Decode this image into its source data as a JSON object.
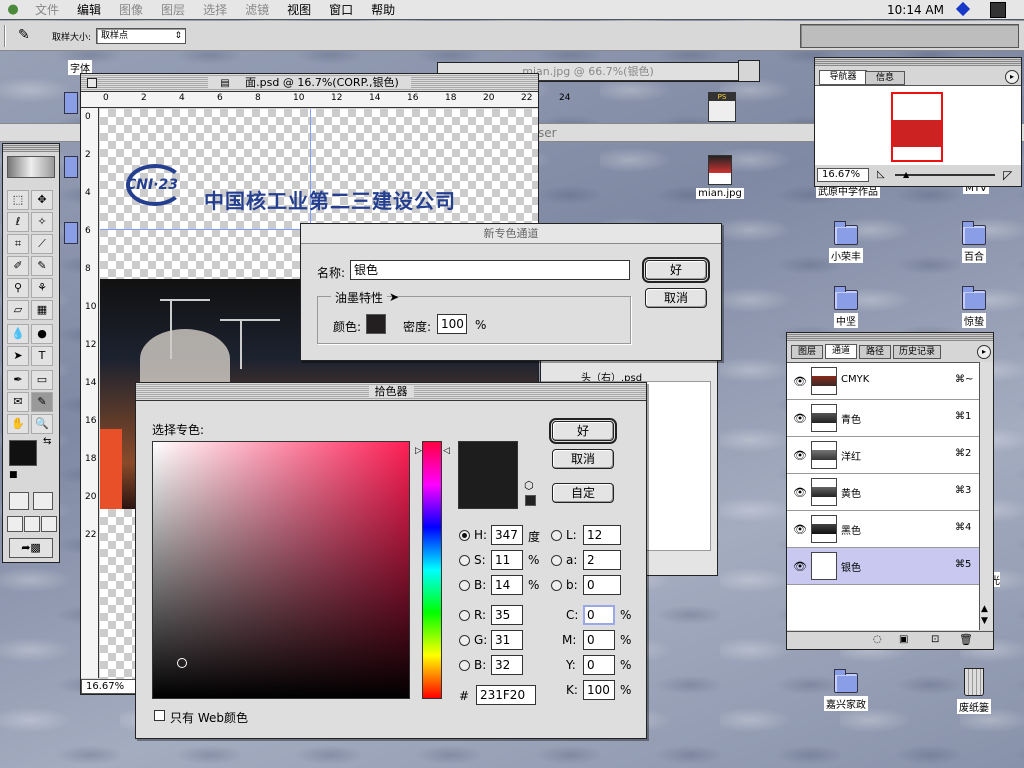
{
  "menubar": {
    "items": [
      "文件",
      "编辑",
      "图像",
      "图层",
      "选择",
      "滤镜",
      "视图",
      "窗口",
      "帮助"
    ],
    "time": "10:14 AM"
  },
  "options": {
    "sample_size_label": "取样大小:",
    "sample_size_value": "取样点"
  },
  "desktop": {
    "icons": [
      {
        "label": "字体"
      },
      {
        "label": "mian.jpg"
      },
      {
        "label": "武原中学作品"
      },
      {
        "label": "MTV"
      },
      {
        "label": "小荣丰"
      },
      {
        "label": "百合"
      },
      {
        "label": "中坚"
      },
      {
        "label": "惊蛰"
      },
      {
        "label": "嘉兴家政"
      },
      {
        "label": "废纸篓"
      }
    ]
  },
  "doc_window": {
    "title": "面.psd @ 16.7%(CORP.,银色)",
    "zoom": "16.67%",
    "ruler": [
      "0",
      "2",
      "4",
      "6",
      "8",
      "10",
      "12",
      "14",
      "16",
      "18",
      "20",
      "22",
      "24"
    ],
    "logo_text": "CNI·23",
    "company": "中国核工业第二三建设公司"
  },
  "doc_window2": {
    "title": "mian.jpg @ 66.7%(银色)",
    "browser_fragment": "ser",
    "file_label": "头（右）.psd"
  },
  "navigator": {
    "tabs": [
      "导航器",
      "信息"
    ],
    "zoom": "16.67%"
  },
  "new_spot_channel": {
    "title": "新专色通道",
    "name_label": "名称:",
    "name_value": "银色",
    "ok": "好",
    "cancel": "取消",
    "ink_group": "油墨特性",
    "color_label": "颜色:",
    "solidity_label": "密度:",
    "solidity_value": "100",
    "percent": "%"
  },
  "color_picker": {
    "title": "拾色器",
    "prompt": "选择专色:",
    "ok": "好",
    "cancel": "取消",
    "custom": "自定",
    "fields": {
      "H": "347",
      "S": "11",
      "B": "14",
      "R": "35",
      "G": "31",
      "B2": "32",
      "L": "12",
      "a": "2",
      "b": "0",
      "C": "0",
      "M": "0",
      "Y": "0",
      "K": "100",
      "hex": "231F20"
    },
    "units": {
      "deg": "度",
      "pct": "%"
    },
    "web_only": "只有 Web颜色",
    "current_color": "#231F20"
  },
  "layers_panel": {
    "tabs": [
      "图层",
      "通道",
      "路径",
      "历史记录"
    ],
    "channels": [
      {
        "name": "CMYK",
        "key": "⌘~"
      },
      {
        "name": "青色",
        "key": "⌘1"
      },
      {
        "name": "洋红",
        "key": "⌘2"
      },
      {
        "name": "黄色",
        "key": "⌘3"
      },
      {
        "name": "黑色",
        "key": "⌘4"
      },
      {
        "name": "银色",
        "key": "⌘5"
      }
    ]
  },
  "colors": {
    "accent_blue": "#1838c8",
    "selected_row": "#c8c8f0"
  }
}
